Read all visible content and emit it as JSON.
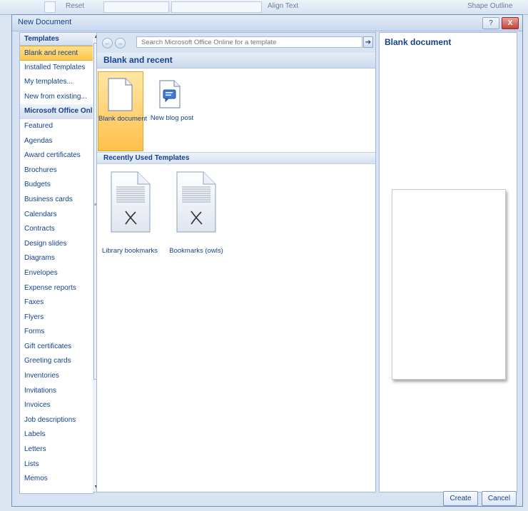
{
  "background": {
    "ribbon_reset_label": "Reset",
    "ribbon_align_text_label": "Align Text",
    "ribbon_shape_outline_label": "Shape Outline"
  },
  "dialog": {
    "title": "New Document",
    "help_button": "?",
    "close_button": "X"
  },
  "left_panel": {
    "header": "Templates",
    "items": [
      {
        "label": "Blank and recent",
        "selected": true
      },
      {
        "label": "Installed Templates"
      },
      {
        "label": "My templates..."
      },
      {
        "label": "New from existing..."
      },
      {
        "label": "Microsoft Office Online",
        "section": true
      },
      {
        "label": "Featured"
      },
      {
        "label": "Agendas"
      },
      {
        "label": "Award certificates"
      },
      {
        "label": "Brochures"
      },
      {
        "label": "Budgets"
      },
      {
        "label": "Business cards"
      },
      {
        "label": "Calendars"
      },
      {
        "label": "Contracts"
      },
      {
        "label": "Design slides"
      },
      {
        "label": "Diagrams"
      },
      {
        "label": "Envelopes"
      },
      {
        "label": "Expense reports"
      },
      {
        "label": "Faxes"
      },
      {
        "label": "Flyers"
      },
      {
        "label": "Forms"
      },
      {
        "label": "Gift certificates"
      },
      {
        "label": "Greeting cards"
      },
      {
        "label": "Inventories"
      },
      {
        "label": "Invitations"
      },
      {
        "label": "Invoices"
      },
      {
        "label": "Job descriptions"
      },
      {
        "label": "Labels"
      },
      {
        "label": "Letters"
      },
      {
        "label": "Lists"
      },
      {
        "label": "Memos"
      }
    ]
  },
  "middle_panel": {
    "search_placeholder": "Search Microsoft Office Online for a template",
    "section_title": "Blank and recent",
    "top_tiles": [
      {
        "label": "Blank document",
        "icon": "blank-document-icon",
        "selected": true
      },
      {
        "label": "New blog post",
        "icon": "blog-post-icon"
      }
    ],
    "recent_header": "Recently Used Templates",
    "recent_tiles": [
      {
        "label": "Library bookmarks",
        "icon": "template-document-icon"
      },
      {
        "label": "Bookmarks (owls)",
        "icon": "template-document-icon"
      }
    ]
  },
  "right_panel": {
    "preview_title": "Blank document"
  },
  "buttons": {
    "create": "Create",
    "cancel": "Cancel"
  }
}
